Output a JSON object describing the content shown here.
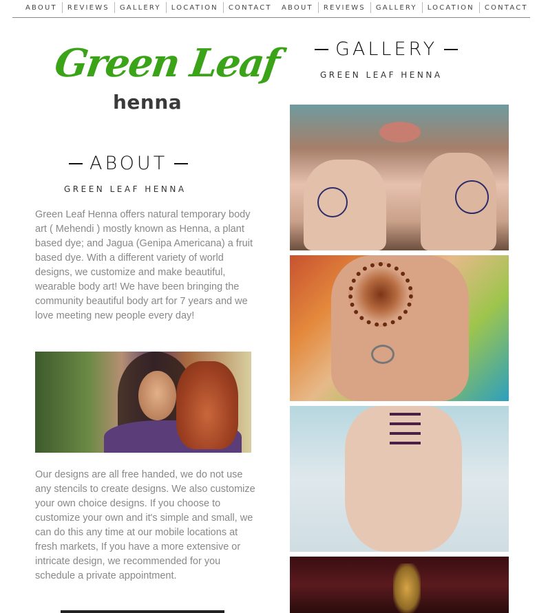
{
  "nav_left": [
    "ABOUT",
    "REVIEWS",
    "GALLERY",
    "LOCATION",
    "CONTACT"
  ],
  "nav_right": [
    "ABOUT",
    "REVIEWS",
    "GALLERY",
    "LOCATION",
    "CONTACT"
  ],
  "logo": {
    "word": "Green Leaf",
    "sub": "henna",
    "color": "#3aa318"
  },
  "about": {
    "title": "ABOUT",
    "subtitle": "GREEN LEAF HENNA",
    "paragraph1": "Green Leaf Henna offers natural temporary body art ( Mehendi ) mostly known as Henna, a plant based dye; and Jagua (Genipa Americana) a fruit based dye. With a different variety of world designs, we customize and make beautiful, wearable body art! We have been bringing the community beautiful body art for 7 years and we love meeting new people every day!",
    "paragraph2": "Our designs are all free handed, we do not use any stencils to create designs. We also customize your own choice designs. If you choose to customize your own and it's simple and small, we can do this any time at our mobile locations at fresh markets, If you have a more extensive or intricate design, we recommended for you schedule a private appointment."
  },
  "gallery": {
    "title": "GALLERY",
    "subtitle": "GREEN LEAF HENNA"
  }
}
